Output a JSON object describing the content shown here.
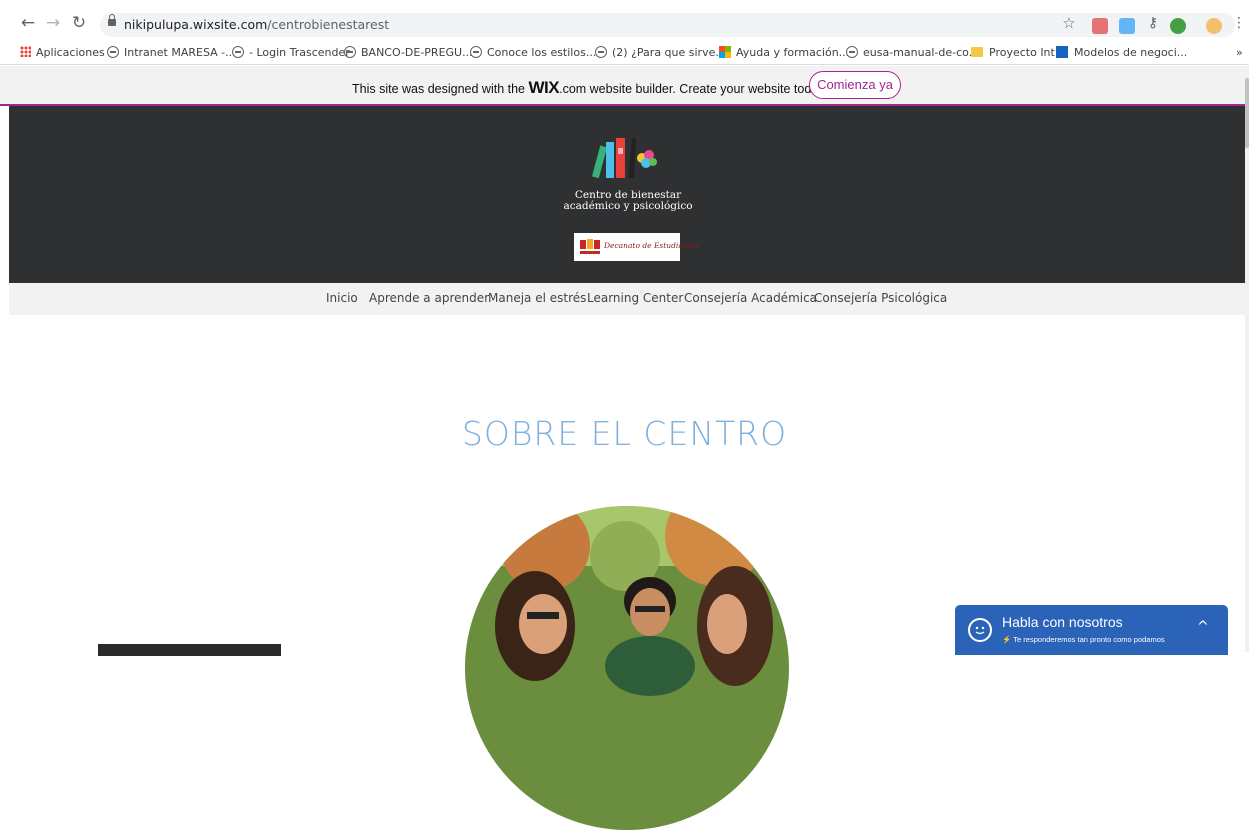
{
  "browser": {
    "url_host": "nikipulupa.wixsite.com",
    "url_path": "/centrobienestarest",
    "bookmarks": [
      "Aplicaciones",
      "Intranet MARESA -...",
      "- Login Trascender",
      "BANCO-DE-PREGU...",
      "Conoce los estilos...",
      "(2) ¿Para que sirve...",
      "Ayuda y formación...",
      "eusa-manual-de-co...",
      "Proyecto Int",
      "Modelos de negoci..."
    ],
    "overflow": "»"
  },
  "wix_banner": {
    "text_before": "This site was designed with the ",
    "brand": "WIX",
    "text_after": ".com website builder. Create your website today.",
    "cta": "Comienza ya"
  },
  "site": {
    "logo_text": "Centro de bienestar académico y psicológico",
    "partner_text": "Decanato de Estudiantes",
    "nav": [
      "Inicio",
      "Aprende a aprender",
      "Maneja el estrés",
      "Learning Center",
      "Consejería Académica",
      "Consejería Psicológica"
    ],
    "section_title": "SOBRE EL CENTRO"
  },
  "chat": {
    "title": "Habla con nosotros",
    "subtitle": "Te responderemos tan pronto como podamos"
  },
  "colors": {
    "wix_accent": "#a12890",
    "header_bg": "#2f3032",
    "title_blue": "#7fb0de",
    "chat_blue": "#2a63b8"
  }
}
